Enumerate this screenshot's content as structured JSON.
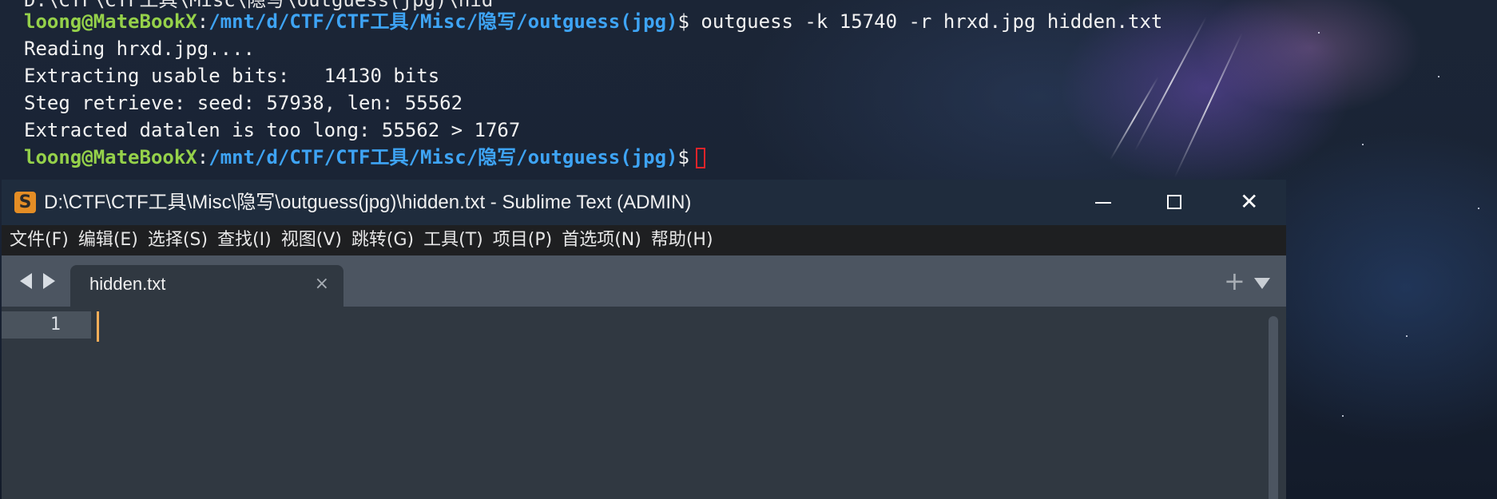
{
  "terminal": {
    "line0_cut": "D:\\CTF\\CTF工具\\Misc\\隐写\\outguess(jpg)\\hid",
    "prompt1": {
      "user": "loong@MateBookX",
      "colon": ":",
      "path": "/mnt/d/CTF/CTF工具/Misc/隐写/outguess(jpg)",
      "dollar": "$",
      "command": " outguess -k 15740 -r hrxd.jpg hidden.txt"
    },
    "output": [
      "Reading hrxd.jpg....",
      "Extracting usable bits:   14130 bits",
      "Steg retrieve: seed: 57938, len: 55562",
      "Extracted datalen is too long: 55562 > 1767"
    ],
    "prompt2": {
      "user": "loong@MateBookX",
      "colon": ":",
      "path": "/mnt/d/CTF/CTF工具/Misc/隐写/outguess(jpg)",
      "dollar": "$"
    }
  },
  "sublime": {
    "app_icon_glyph": "S",
    "title": "D:\\CTF\\CTF工具\\Misc\\隐写\\outguess(jpg)\\hidden.txt - Sublime Text (ADMIN)",
    "window_buttons": {
      "minimize": "minimize-icon",
      "maximize": "maximize-icon",
      "close": "✕"
    },
    "menu": [
      "文件(F)",
      "编辑(E)",
      "选择(S)",
      "查找(I)",
      "视图(V)",
      "跳转(G)",
      "工具(T)",
      "项目(P)",
      "首选项(N)",
      "帮助(H)"
    ],
    "tab": {
      "label": "hidden.txt",
      "close": "×"
    },
    "new_tab": "+",
    "editor": {
      "line_number": "1"
    },
    "colors": {
      "titlebar": "#1f2c3d",
      "menubar": "#1e1f21",
      "tabbar": "#4c5561",
      "editor_bg": "#303841",
      "cursor": "#f9ae58"
    }
  }
}
